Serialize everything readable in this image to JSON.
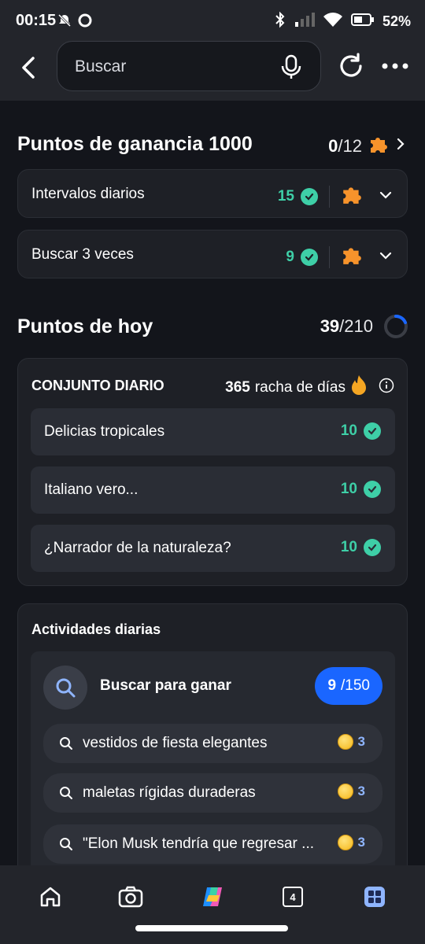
{
  "status_bar": {
    "time": "00:15",
    "battery": "52%",
    "icons": [
      "notifications-off-icon",
      "circle-icon",
      "bluetooth-icon",
      "signal-icon",
      "wifi-icon",
      "battery-icon"
    ]
  },
  "app_bar": {
    "search_placeholder": "Buscar",
    "icons": [
      "back-icon",
      "mic-icon",
      "refresh-icon",
      "more-icon"
    ]
  },
  "earning_points": {
    "title": "Puntos de ganancia 1000",
    "progress_current": "0",
    "progress_total": "/12",
    "rows": [
      {
        "label": "Intervalos diarios",
        "points": "15"
      },
      {
        "label": "Buscar 3 veces",
        "points": "9"
      }
    ]
  },
  "today_points": {
    "title": "Puntos de hoy",
    "current": "39",
    "total": "/210",
    "progress_fraction": 0.186
  },
  "daily_set": {
    "title": "CONJUNTO DIARIO",
    "streak_count": "365",
    "streak_label": "racha de días",
    "items": [
      {
        "label": "Delicias tropicales",
        "points": "10"
      },
      {
        "label": "Italiano vero...",
        "points": "10"
      },
      {
        "label": "¿Narrador de la naturaleza?",
        "points": "10"
      }
    ]
  },
  "daily_activities": {
    "title": "Actividades diarias",
    "search_earn_label": "Buscar para ganar",
    "search_earn_current": "9",
    "search_earn_total": "/150",
    "suggestions": [
      {
        "text": "vestidos de fiesta elegantes",
        "points": "3"
      },
      {
        "text": "maletas rígidas duraderas",
        "points": "3"
      },
      {
        "text": "\"Elon Musk tendría que regresar ...",
        "points": "3"
      }
    ]
  },
  "bottom_nav": {
    "tabs_count": "4",
    "items": [
      "home-icon",
      "camera-icon",
      "copilot-icon",
      "tabs-icon",
      "apps-icon"
    ]
  },
  "colors": {
    "background": "#13151b",
    "card": "#1e2026",
    "accent_teal": "#3ecfa7",
    "accent_blue": "#1a66ff",
    "puzzle_orange": "#f7932b"
  }
}
